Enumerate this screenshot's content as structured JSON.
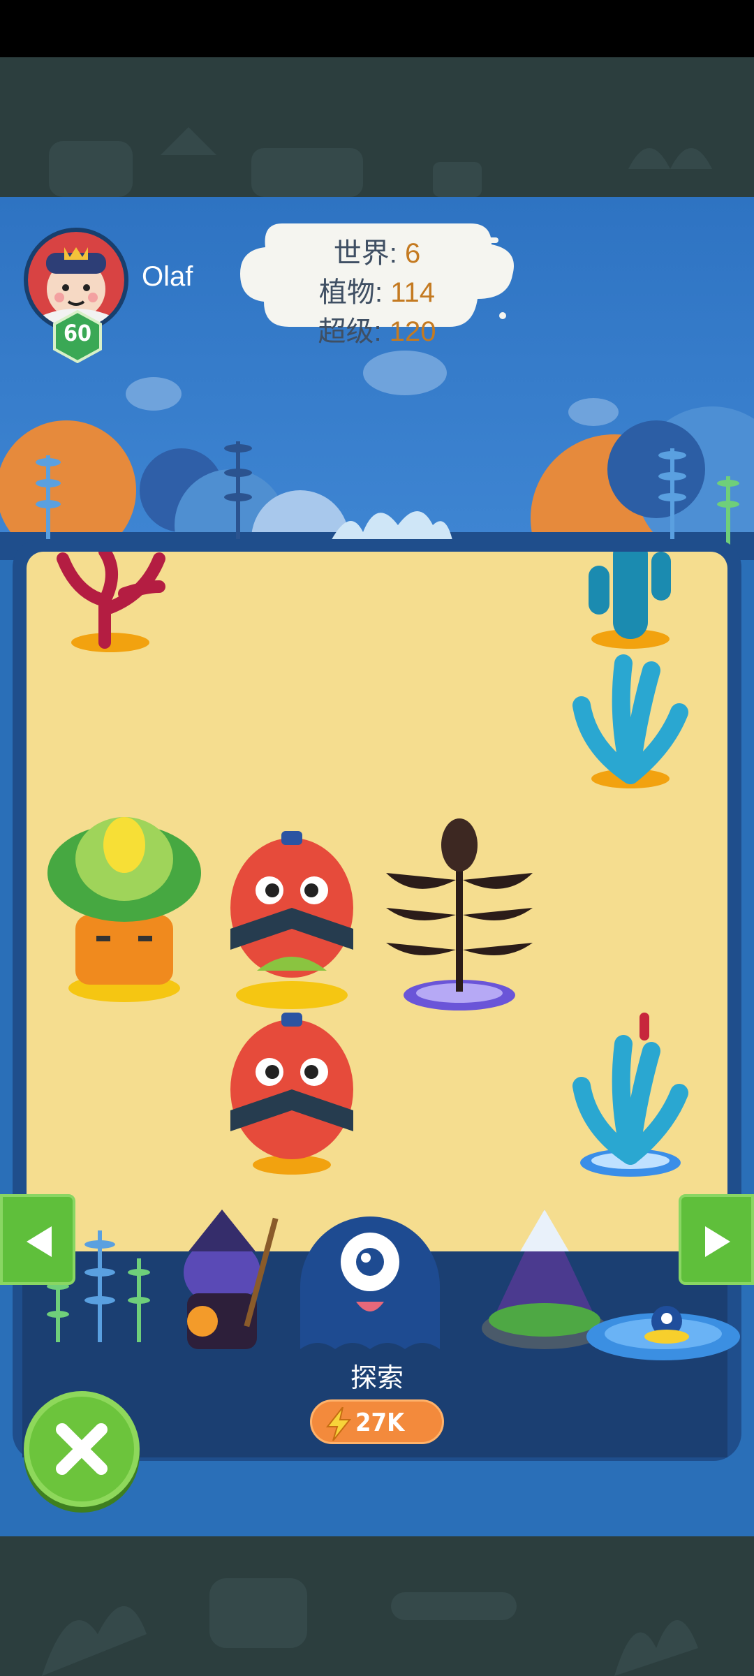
{
  "player": {
    "name": "Olaf",
    "level": "60"
  },
  "stats": {
    "world_label": "世界:",
    "world_value": "6",
    "plants_label": "植物:",
    "plants_value": "114",
    "super_label": "超级:",
    "super_value": "120"
  },
  "explore": {
    "label": "探索",
    "energy": "27K"
  },
  "colors": {
    "sky": "#3f86d3",
    "sand": "#f5dd8f",
    "button_green": "#5fbf3b",
    "energy_orange": "#f38a3c",
    "stat_value": "#c47a21"
  },
  "icons": [
    "avatar",
    "level-badge",
    "energy-bolt-icon",
    "left-arrow-icon",
    "right-arrow-icon",
    "close-icon"
  ]
}
